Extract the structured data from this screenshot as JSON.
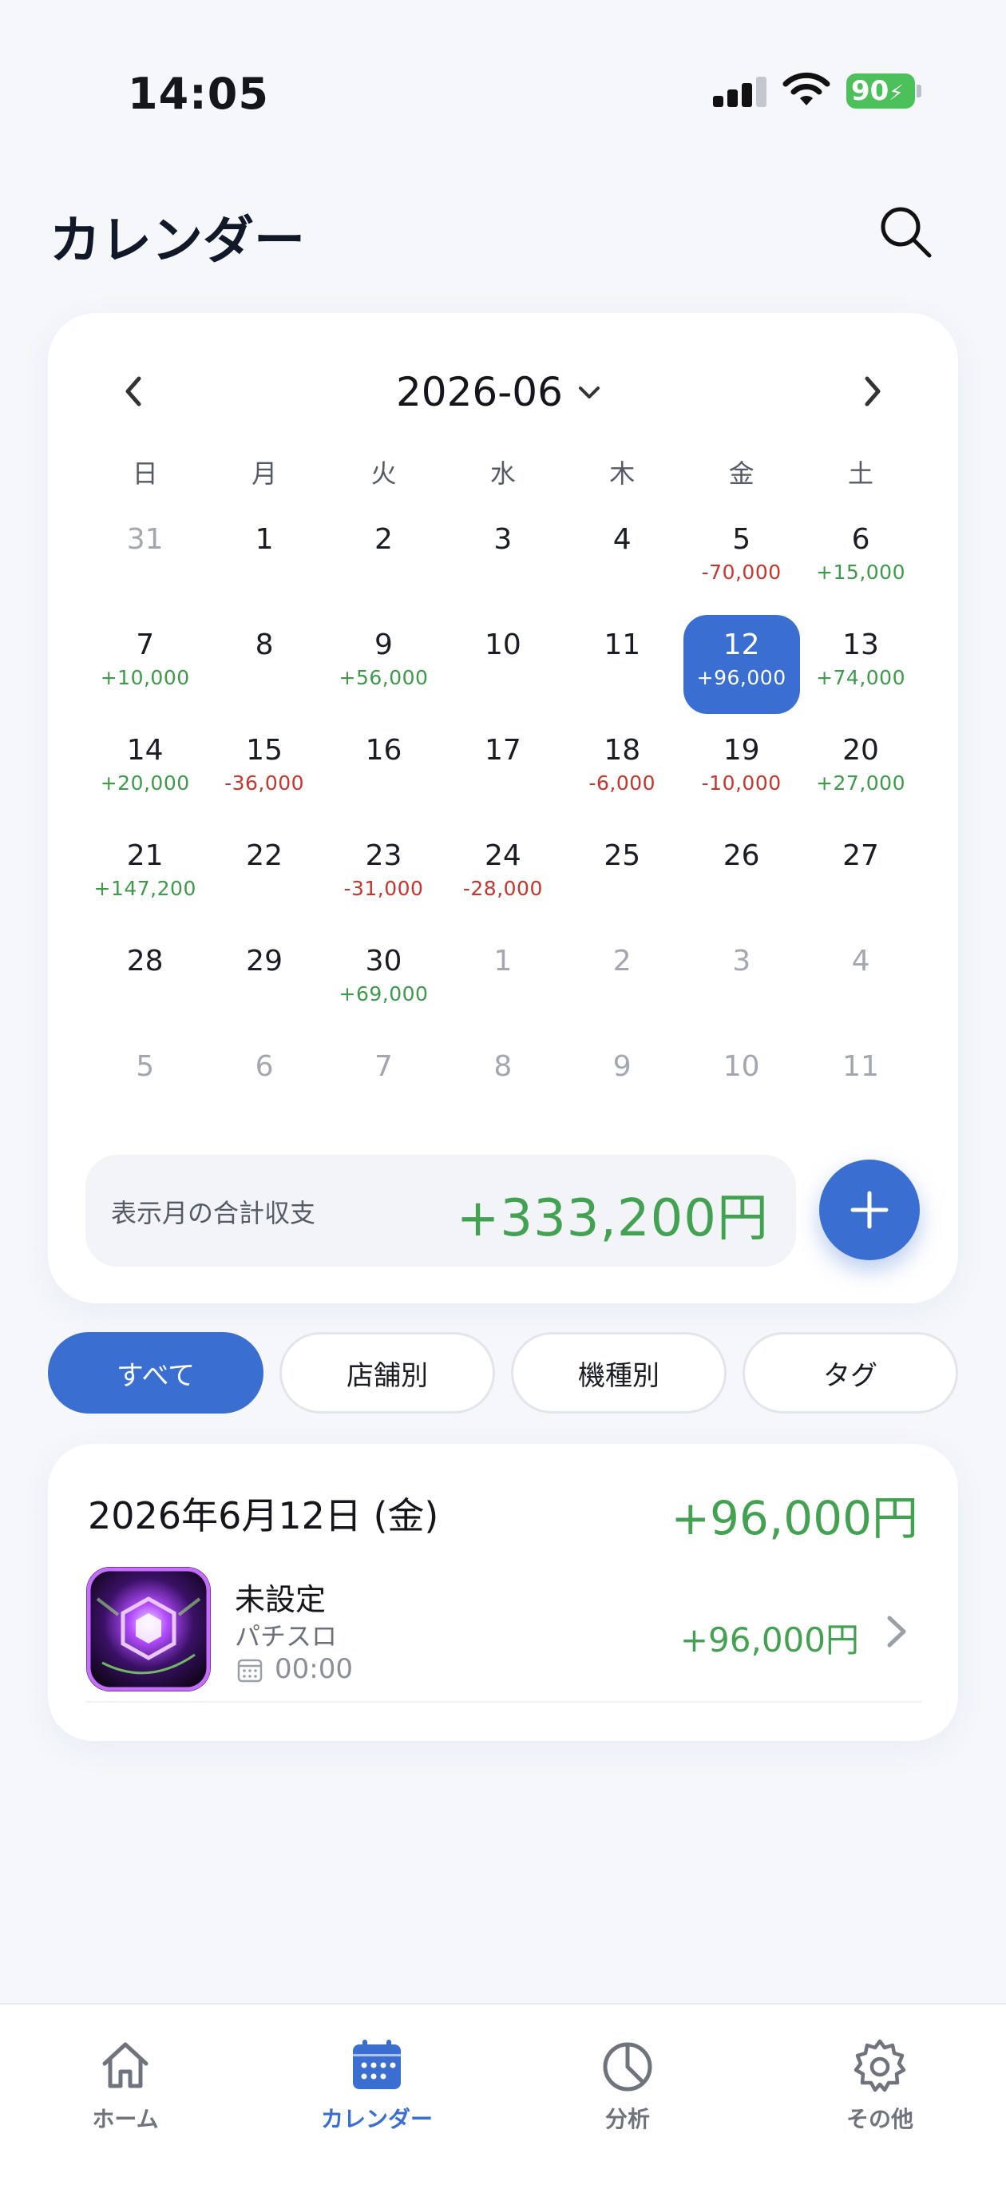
{
  "status_bar": {
    "time": "14:05",
    "battery": "90"
  },
  "header": {
    "title": "カレンダー"
  },
  "calendar": {
    "month": "2026-06",
    "weekdays": [
      "日",
      "月",
      "火",
      "水",
      "木",
      "金",
      "土"
    ],
    "days": [
      {
        "n": "31",
        "amt": "",
        "other": true
      },
      {
        "n": "1",
        "amt": ""
      },
      {
        "n": "2",
        "amt": ""
      },
      {
        "n": "3",
        "amt": ""
      },
      {
        "n": "4",
        "amt": ""
      },
      {
        "n": "5",
        "amt": "-70,000"
      },
      {
        "n": "6",
        "amt": "+15,000"
      },
      {
        "n": "7",
        "amt": "+10,000"
      },
      {
        "n": "8",
        "amt": ""
      },
      {
        "n": "9",
        "amt": "+56,000"
      },
      {
        "n": "10",
        "amt": ""
      },
      {
        "n": "11",
        "amt": ""
      },
      {
        "n": "12",
        "amt": "+96,000",
        "selected": true
      },
      {
        "n": "13",
        "amt": "+74,000"
      },
      {
        "n": "14",
        "amt": "+20,000"
      },
      {
        "n": "15",
        "amt": "-36,000"
      },
      {
        "n": "16",
        "amt": ""
      },
      {
        "n": "17",
        "amt": ""
      },
      {
        "n": "18",
        "amt": "-6,000"
      },
      {
        "n": "19",
        "amt": "-10,000"
      },
      {
        "n": "20",
        "amt": "+27,000"
      },
      {
        "n": "21",
        "amt": "+147,200"
      },
      {
        "n": "22",
        "amt": ""
      },
      {
        "n": "23",
        "amt": "-31,000"
      },
      {
        "n": "24",
        "amt": "-28,000"
      },
      {
        "n": "25",
        "amt": ""
      },
      {
        "n": "26",
        "amt": ""
      },
      {
        "n": "27",
        "amt": ""
      },
      {
        "n": "28",
        "amt": ""
      },
      {
        "n": "29",
        "amt": ""
      },
      {
        "n": "30",
        "amt": "+69,000"
      },
      {
        "n": "1",
        "amt": "",
        "other": true
      },
      {
        "n": "2",
        "amt": "",
        "other": true
      },
      {
        "n": "3",
        "amt": "",
        "other": true
      },
      {
        "n": "4",
        "amt": "",
        "other": true
      },
      {
        "n": "5",
        "amt": "",
        "other": true
      },
      {
        "n": "6",
        "amt": "",
        "other": true
      },
      {
        "n": "7",
        "amt": "",
        "other": true
      },
      {
        "n": "8",
        "amt": "",
        "other": true
      },
      {
        "n": "9",
        "amt": "",
        "other": true
      },
      {
        "n": "10",
        "amt": "",
        "other": true
      },
      {
        "n": "11",
        "amt": "",
        "other": true
      }
    ],
    "total_label": "表示月の合計収支",
    "total_value": "+333,200円"
  },
  "filters": [
    {
      "label": "すべて",
      "active": true
    },
    {
      "label": "店舗別"
    },
    {
      "label": "機種別"
    },
    {
      "label": "タグ"
    }
  ],
  "entry_group": {
    "date": "2026年6月12日 (金)",
    "total": "+96,000円",
    "items": [
      {
        "title": "未設定",
        "type": "パチスロ",
        "time": "00:00",
        "amount": "+96,000円"
      }
    ]
  },
  "tab_bar": {
    "tabs": [
      {
        "label": "ホーム",
        "icon": "home-icon"
      },
      {
        "label": "カレンダー",
        "icon": "calendar-icon",
        "active": true
      },
      {
        "label": "分析",
        "icon": "pie-chart-icon"
      },
      {
        "label": "その他",
        "icon": "gear-icon"
      }
    ]
  },
  "colors": {
    "accent": "#3a6fd1",
    "positive": "#43a152",
    "negative": "#c9352c"
  }
}
